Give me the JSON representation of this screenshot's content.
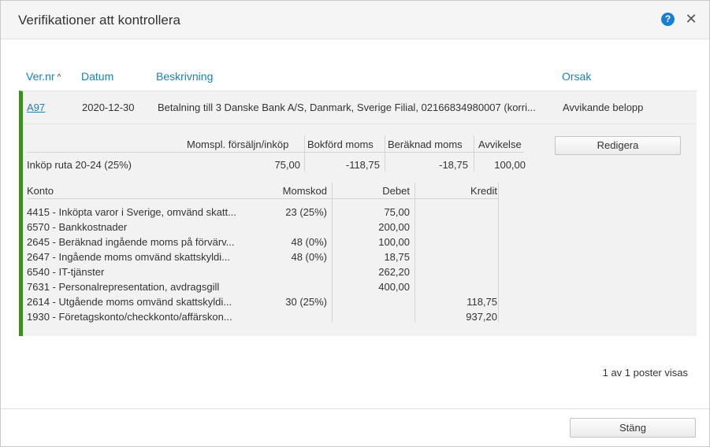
{
  "dialog": {
    "title": "Verifikationer att kontrollera",
    "help_symbol": "?",
    "close_symbol": "✕"
  },
  "columns": {
    "vernr": "Ver.nr",
    "datum": "Datum",
    "beskrivning": "Beskrivning",
    "orsak": "Orsak",
    "sort_symbol": "^"
  },
  "row": {
    "vernr": "A97",
    "datum": "2020-12-30",
    "beskrivning": "Betalning till 3 Danske Bank A/S, Danmark, Sverige Filial, 02166834980007 (korri...",
    "orsak": "Avvikande belopp"
  },
  "moms": {
    "headers": {
      "forsaljn": "Momspl. försäljn/inköp",
      "bokford": "Bokförd moms",
      "beraknad": "Beräknad moms",
      "avvikelse": "Avvikelse"
    },
    "row": {
      "label": "Inköp ruta 20-24 (25%)",
      "forsaljn": "75,00",
      "bokford": "-118,75",
      "beraknad": "-18,75",
      "avvikelse": "100,00"
    }
  },
  "edit_button": "Redigera",
  "konto": {
    "headers": {
      "konto": "Konto",
      "momskod": "Momskod",
      "debet": "Debet",
      "kredit": "Kredit"
    },
    "rows": [
      {
        "konto": "4415 - Inköpta varor i Sverige, omvänd skatt...",
        "momskod": "23 (25%)",
        "debet": "75,00",
        "kredit": ""
      },
      {
        "konto": "6570 - Bankkostnader",
        "momskod": "",
        "debet": "200,00",
        "kredit": ""
      },
      {
        "konto": "2645 - Beräknad ingående moms på förvärv...",
        "momskod": "48 (0%)",
        "debet": "100,00",
        "kredit": ""
      },
      {
        "konto": "2647 - Ingående moms omvänd skattskyldi...",
        "momskod": "48 (0%)",
        "debet": "18,75",
        "kredit": ""
      },
      {
        "konto": "6540 - IT-tjänster",
        "momskod": "",
        "debet": "262,20",
        "kredit": ""
      },
      {
        "konto": "7631 - Personalrepresentation, avdragsgill",
        "momskod": "",
        "debet": "400,00",
        "kredit": ""
      },
      {
        "konto": "2614 - Utgående moms omvänd skattskyldi...",
        "momskod": "30 (25%)",
        "debet": "",
        "kredit": "118,75"
      },
      {
        "konto": "1930 - Företagskonto/checkkonto/affärskon...",
        "momskod": "",
        "debet": "",
        "kredit": "937,20"
      }
    ]
  },
  "pagination": "1 av 1 poster visas",
  "close_button": "Stäng",
  "colors": {
    "accent": "#1a7fb8",
    "row_marker": "#3d8f23",
    "help_icon": "#1a7fd4"
  }
}
